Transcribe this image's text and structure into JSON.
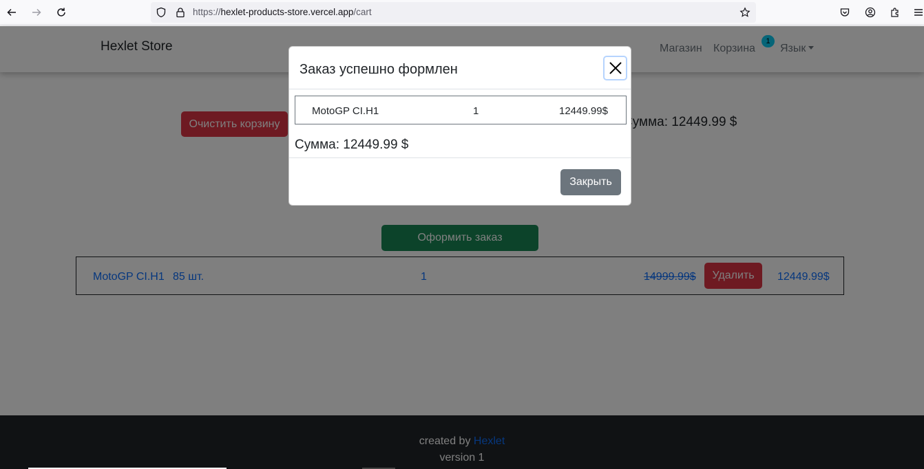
{
  "browser": {
    "url_scheme": "https://",
    "url_host": "hexlet-products-store.vercel.app",
    "url_path": "/cart"
  },
  "navbar": {
    "brand": "Hexlet Store",
    "shop_link": "Магазин",
    "cart_link": "Корзина",
    "cart_badge": "1",
    "language_link": "Язык"
  },
  "cart": {
    "clear_button": "Очистить корзину",
    "total_label": "Сумма: 12449.99 $",
    "order_button": "Оформить заказ",
    "items": [
      {
        "name": "MotoGP CI.H1",
        "stock": "85 шт.",
        "quantity": "1",
        "old_price": "14999.99$",
        "delete_button": "Удалить",
        "price": "12449.99$"
      }
    ]
  },
  "modal": {
    "title": "Заказ успешно формлен",
    "items": [
      {
        "name": "MotoGP CI.H1",
        "quantity": "1",
        "price": "12449.99$"
      }
    ],
    "sum": "Сумма: 12449.99 $",
    "close_button": "Закрыть"
  },
  "footer": {
    "created_by": "created by",
    "author_link": "Hexlet",
    "version": "version 1"
  },
  "colors": {
    "danger": "#dc3545",
    "success": "#198754",
    "secondary": "#6c757d",
    "link": "#0d6efd",
    "badge": "#0dcaf0",
    "footer_bg": "#212529"
  }
}
